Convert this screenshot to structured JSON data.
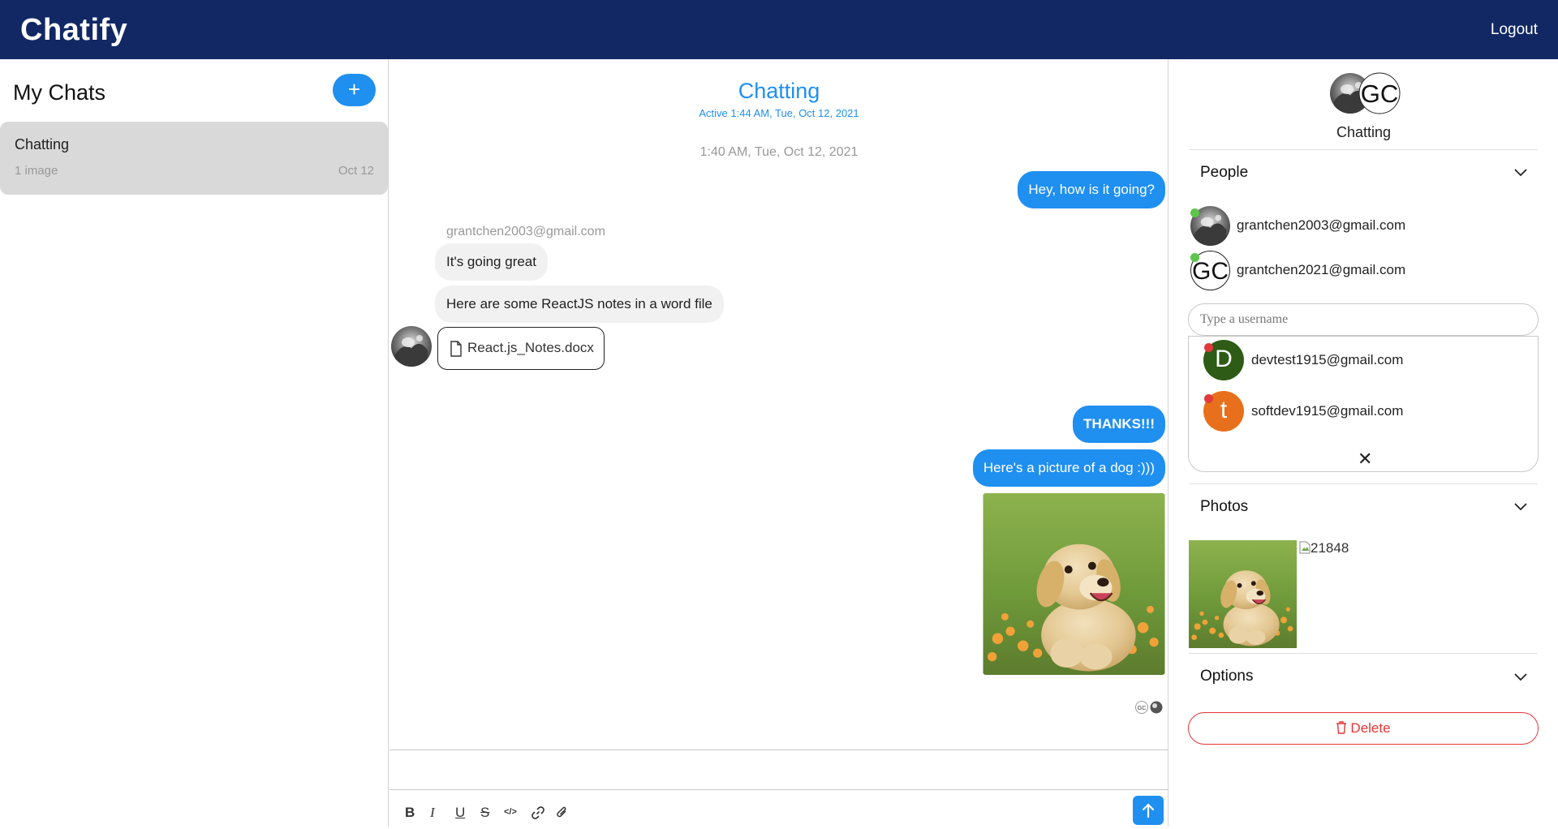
{
  "app": {
    "brand": "Chatify",
    "logout_label": "Logout"
  },
  "sidebar": {
    "title": "My Chats",
    "new_chat_label": "+",
    "chats": [
      {
        "title": "Chatting",
        "preview": "1 image",
        "date": "Oct 12"
      }
    ]
  },
  "chat": {
    "title": "Chatting",
    "active_status": "Active 1:44 AM, Tue, Oct 12, 2021",
    "timestamp": "1:40 AM, Tue, Oct 12, 2021",
    "messages": [
      {
        "direction": "out",
        "text": "Hey, how is it going?"
      },
      {
        "direction": "in",
        "sender": "grantchen2003@gmail.com",
        "text": "It's going great"
      },
      {
        "direction": "in",
        "text": "Here are some ReactJS notes in a word file"
      },
      {
        "direction": "in",
        "file": "React.js_Notes.docx"
      },
      {
        "direction": "out",
        "text": "THANKS!!!"
      },
      {
        "direction": "out",
        "text": "Here's a picture of a dog :)))"
      },
      {
        "direction": "out",
        "image": "dog photo"
      }
    ],
    "read_receipt_initials": "GC",
    "composer": {
      "format_buttons": [
        "B",
        "I",
        "U",
        "S",
        "</>",
        "link",
        "attach"
      ],
      "send_label": "send"
    }
  },
  "details": {
    "title": "Chatting",
    "header_initials": "GC",
    "people_title": "People",
    "people": [
      {
        "email": "grantchen2003@gmail.com",
        "avatar": "photo",
        "status": "online"
      },
      {
        "email": "grantchen2021@gmail.com",
        "avatar": "GC",
        "status": "online"
      }
    ],
    "search_placeholder": "Type a username",
    "suggestions": [
      {
        "initial": "D",
        "email": "devtest1915@gmail.com",
        "color": "#2e5b16",
        "status": "offline"
      },
      {
        "initial": "t",
        "email": "softdev1915@gmail.com",
        "color": "#e8701c",
        "status": "offline"
      }
    ],
    "close_label": "✕",
    "photos_title": "Photos",
    "broken_photo_alt": "21848",
    "options_title": "Options",
    "delete_label": "Delete"
  },
  "colors": {
    "topbar": "#112864",
    "accent": "#1f8ff0",
    "danger": "#e63535",
    "online": "#5cc64a",
    "offline": "#e03a3a"
  }
}
